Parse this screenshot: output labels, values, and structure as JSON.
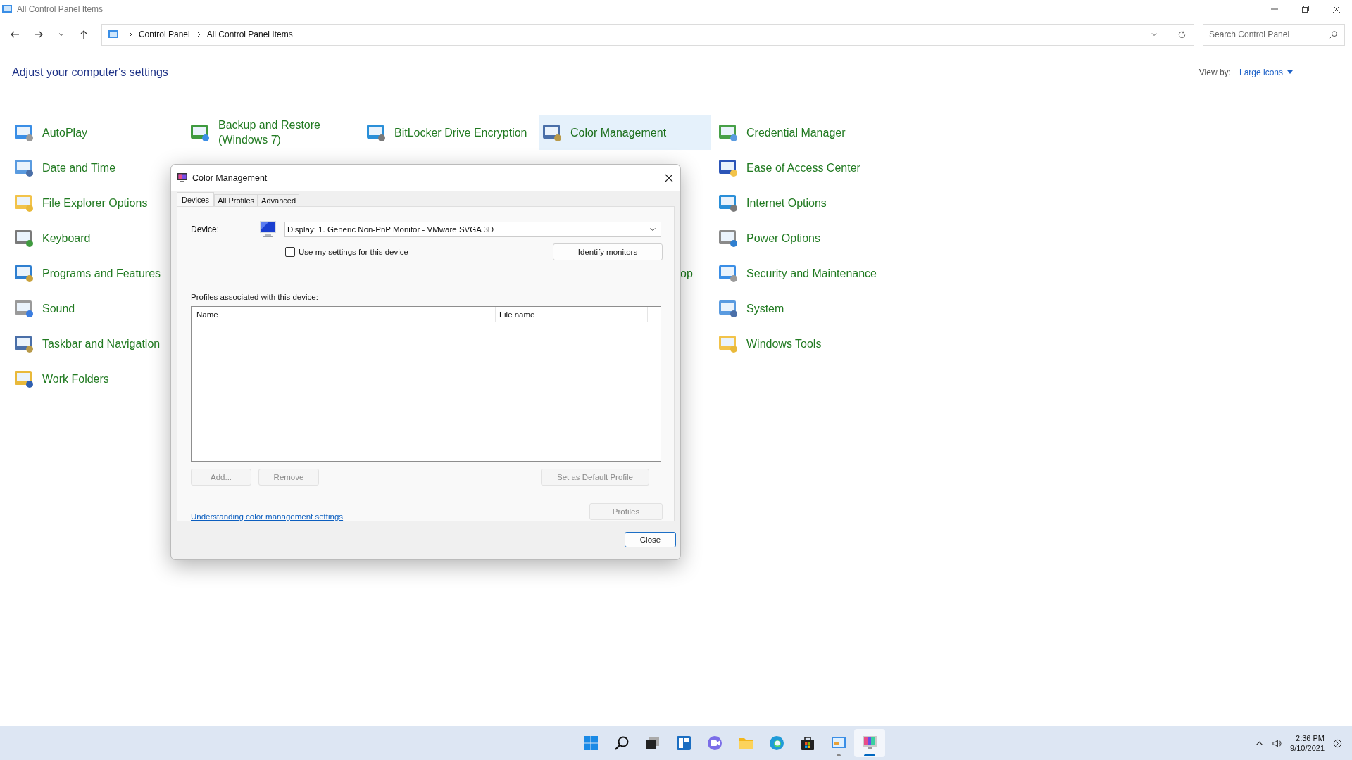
{
  "window": {
    "title": "All Control Panel Items"
  },
  "address_bar": {
    "breadcrumbs": [
      "Control Panel",
      "All Control Panel Items"
    ]
  },
  "search": {
    "placeholder": "Search Control Panel"
  },
  "header": {
    "title": "Adjust your computer's settings",
    "view_by_label": "View by:",
    "view_by_value": "Large icons"
  },
  "columns": [
    {
      "items": [
        {
          "label": "AutoPlay",
          "selected": false
        },
        {
          "label": "Date and Time",
          "selected": false
        },
        {
          "label": "File Explorer Options",
          "selected": false
        },
        {
          "label": "Keyboard",
          "selected": false
        },
        {
          "label": "Programs and Features",
          "selected": false
        },
        {
          "label": "Sound",
          "selected": false
        },
        {
          "label": "Taskbar and Navigation",
          "selected": false
        },
        {
          "label": "Work Folders",
          "selected": false
        }
      ]
    },
    {
      "items": [
        {
          "label": "Backup and Restore (Windows 7)",
          "selected": false
        }
      ]
    },
    {
      "items": [
        {
          "label": "BitLocker Drive Encryption",
          "selected": false
        }
      ]
    },
    {
      "items": [
        {
          "label": "Color Management",
          "selected": true
        }
      ],
      "covered_fragment": "op"
    },
    {
      "items": [
        {
          "label": "Credential Manager",
          "selected": false
        },
        {
          "label": "Ease of Access Center",
          "selected": false
        },
        {
          "label": "Internet Options",
          "selected": false
        },
        {
          "label": "Power Options",
          "selected": false
        },
        {
          "label": "Security and Maintenance",
          "selected": false
        },
        {
          "label": "System",
          "selected": false
        },
        {
          "label": "Windows Tools",
          "selected": false
        }
      ]
    }
  ],
  "dialog": {
    "title": "Color Management",
    "tabs": [
      {
        "label": "Devices",
        "selected": true
      },
      {
        "label": "All Profiles",
        "selected": false
      },
      {
        "label": "Advanced",
        "selected": false
      }
    ],
    "device_label": "Device:",
    "device_value": "Display: 1. Generic Non-PnP Monitor - VMware SVGA 3D",
    "use_my_settings": {
      "label": "Use my settings for this device",
      "checked": false
    },
    "identify_button": {
      "label": "Identify monitors",
      "disabled": false
    },
    "profiles_label": "Profiles associated with this device:",
    "columns": [
      "Name",
      "File name"
    ],
    "list_buttons": [
      {
        "label": "Add...",
        "disabled": true
      },
      {
        "label": "Remove",
        "disabled": true
      },
      {
        "label": "Set as Default Profile",
        "disabled": true
      }
    ],
    "link": "Understanding color management settings",
    "profiles_button": {
      "label": "Profiles",
      "disabled": true
    },
    "close_button": "Close"
  },
  "taskbar": {
    "apps": [
      {
        "kind": "start",
        "running": false,
        "selected": false
      },
      {
        "kind": "search",
        "running": false,
        "selected": false
      },
      {
        "kind": "taskview",
        "running": false,
        "selected": false
      },
      {
        "kind": "widgets",
        "running": false,
        "selected": false
      },
      {
        "kind": "chat",
        "running": false,
        "selected": false
      },
      {
        "kind": "folder",
        "running": false,
        "selected": false
      },
      {
        "kind": "browser",
        "running": false,
        "selected": false
      },
      {
        "kind": "store",
        "running": false,
        "selected": false
      },
      {
        "kind": "controlpanel",
        "running": true,
        "selected": false
      },
      {
        "kind": "monitor",
        "running": true,
        "selected": true
      }
    ],
    "time": "2:36 PM",
    "date": "9/10/2021"
  }
}
